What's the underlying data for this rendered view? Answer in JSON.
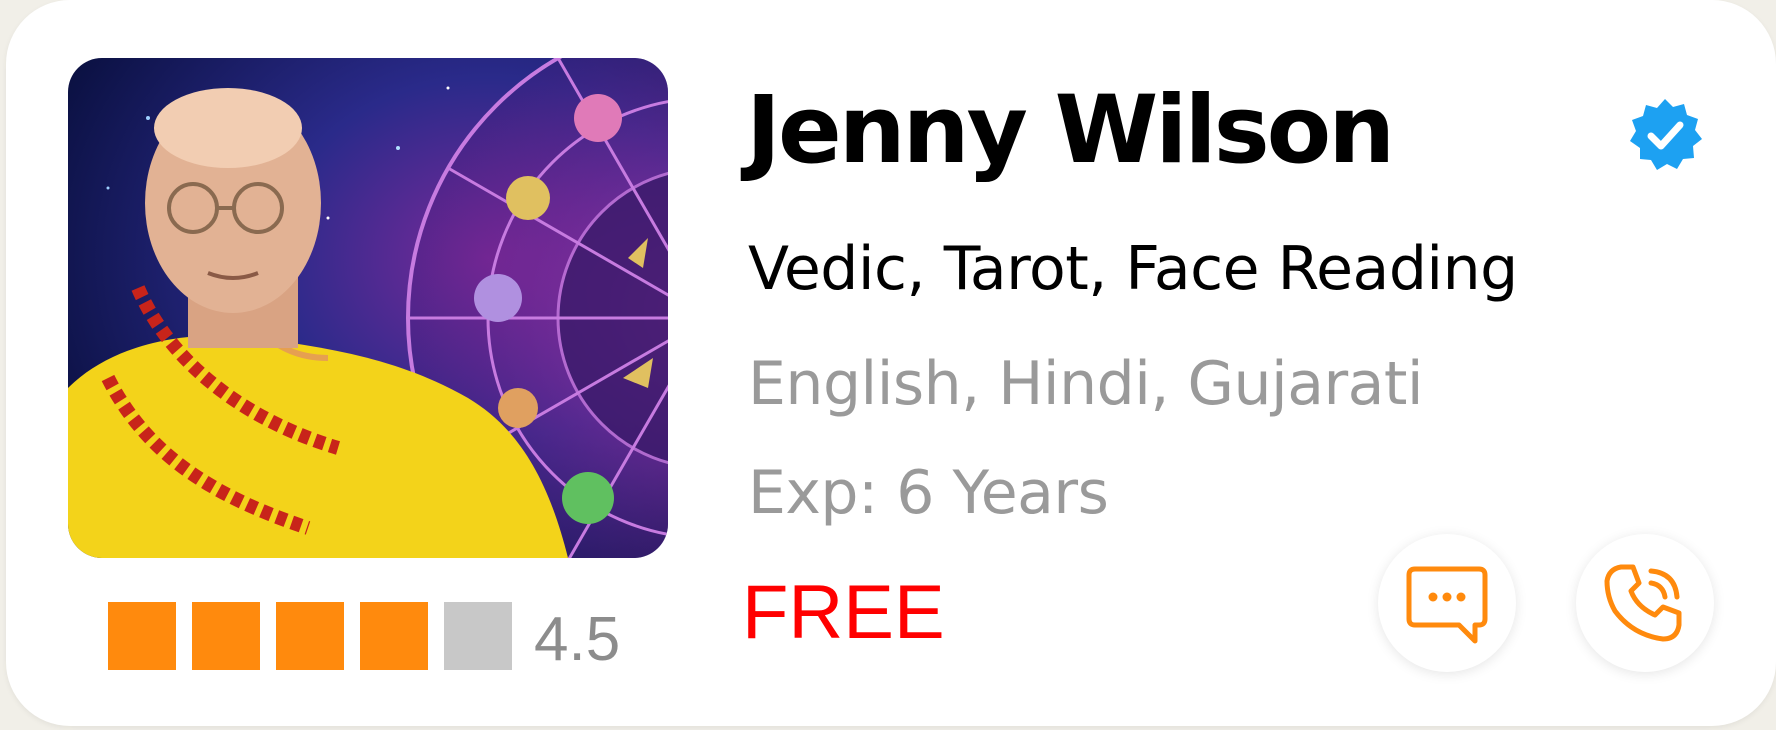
{
  "astrologer": {
    "name": "Jenny Wilson",
    "skills": "Vedic, Tarot, Face Reading",
    "languages": "English, Hindi, Gujarati",
    "experience": "Exp: 6 Years",
    "price": "FREE",
    "rating": {
      "value": "4.5",
      "filled_blocks": 4,
      "total_blocks": 5
    },
    "verified": true
  },
  "icons": {
    "verified": "verified-badge-icon",
    "chat": "chat-bubble-icon",
    "call": "phone-call-icon"
  },
  "colors": {
    "accent_orange": "#ff8a0d",
    "rating_empty": "#c8c8c8",
    "price_red": "#ff0000",
    "verified_blue": "#1da1f2",
    "muted_text": "#9a9a9a"
  }
}
